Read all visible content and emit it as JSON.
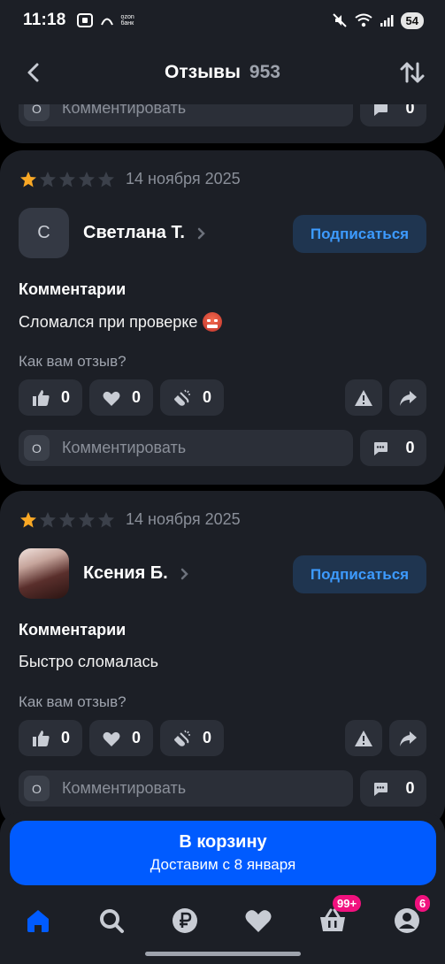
{
  "status_bar": {
    "time": "11:18",
    "ozon_label_top": "ozon",
    "ozon_label_bottom": "банк",
    "battery": "54"
  },
  "header": {
    "title": "Отзывы",
    "count": "953"
  },
  "previous_card": {
    "comment_placeholder": "Комментировать",
    "comment_count": "0"
  },
  "reviews": [
    {
      "rating": 1,
      "date": "14 ноября 2025",
      "avatar_letter": "С",
      "author": "Светлана Т.",
      "subscribe_label": "Подписаться",
      "section_title": "Комментарии",
      "text": "Сломался при проверке",
      "emoji": "angry-face-emoji",
      "question": "Как вам отзыв?",
      "likes": "0",
      "hearts": "0",
      "claps": "0",
      "comment_avatar": "О",
      "comment_placeholder": "Комментировать",
      "comment_count": "0"
    },
    {
      "rating": 1,
      "date": "14 ноября 2025",
      "avatar_letter": "",
      "author": "Ксения Б.",
      "subscribe_label": "Подписаться",
      "section_title": "Комментарии",
      "text": "Быстро сломалась",
      "question": "Как вам отзыв?",
      "likes": "0",
      "hearts": "0",
      "claps": "0",
      "comment_avatar": "О",
      "comment_placeholder": "Комментировать",
      "comment_count": "0"
    }
  ],
  "cart": {
    "title": "В корзину",
    "subtitle": "Доставим с 8 января"
  },
  "tabbar": {
    "items": [
      "home-icon",
      "search-icon",
      "ruble-icon",
      "heart-icon",
      "basket-icon",
      "profile-icon"
    ],
    "cart_badge": "99+",
    "profile_badge": "6"
  },
  "colors": {
    "accent": "#005bff",
    "star": "#f9a825",
    "badge": "#f1117e",
    "subscribe_text": "#3d9bff"
  }
}
